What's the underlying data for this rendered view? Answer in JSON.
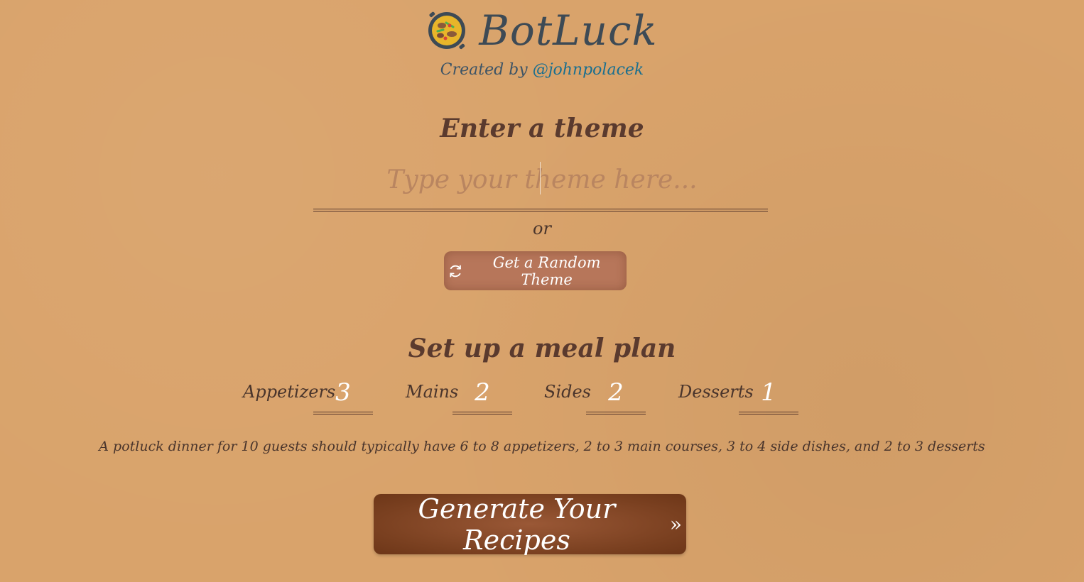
{
  "brand": {
    "name": "BotLuck",
    "logo_icon": "paella-pan-icon",
    "credit_prefix": "Created by ",
    "credit_handle": "@johnpolacek"
  },
  "theme": {
    "title": "Enter a theme",
    "input_value": "",
    "placeholder": "Type your theme here...",
    "or_text": "or",
    "random_button_label": "Get a Random Theme",
    "random_icon": "refresh-icon"
  },
  "meal_plan": {
    "title": "Set up a meal plan",
    "items": [
      {
        "label": "Appetizers",
        "value": "3"
      },
      {
        "label": "Mains",
        "value": "2"
      },
      {
        "label": "Sides",
        "value": "2"
      },
      {
        "label": "Desserts",
        "value": "1"
      }
    ],
    "hint": "A potluck dinner for 10 guests should typically have 6 to 8 appetizers, 2 to 3 main courses, 3 to 4 side dishes, and 2 to 3 desserts"
  },
  "generate": {
    "label": "Generate Your Recipes",
    "icon": "double-chevron-right-icon"
  },
  "colors": {
    "background": "#d9a36b",
    "text_brown": "#5a3a2e",
    "brand_slate": "#3d4a55",
    "link_blue": "#1a6f8f",
    "random_button": "#b7765a",
    "generate_button": "#7a4020"
  }
}
